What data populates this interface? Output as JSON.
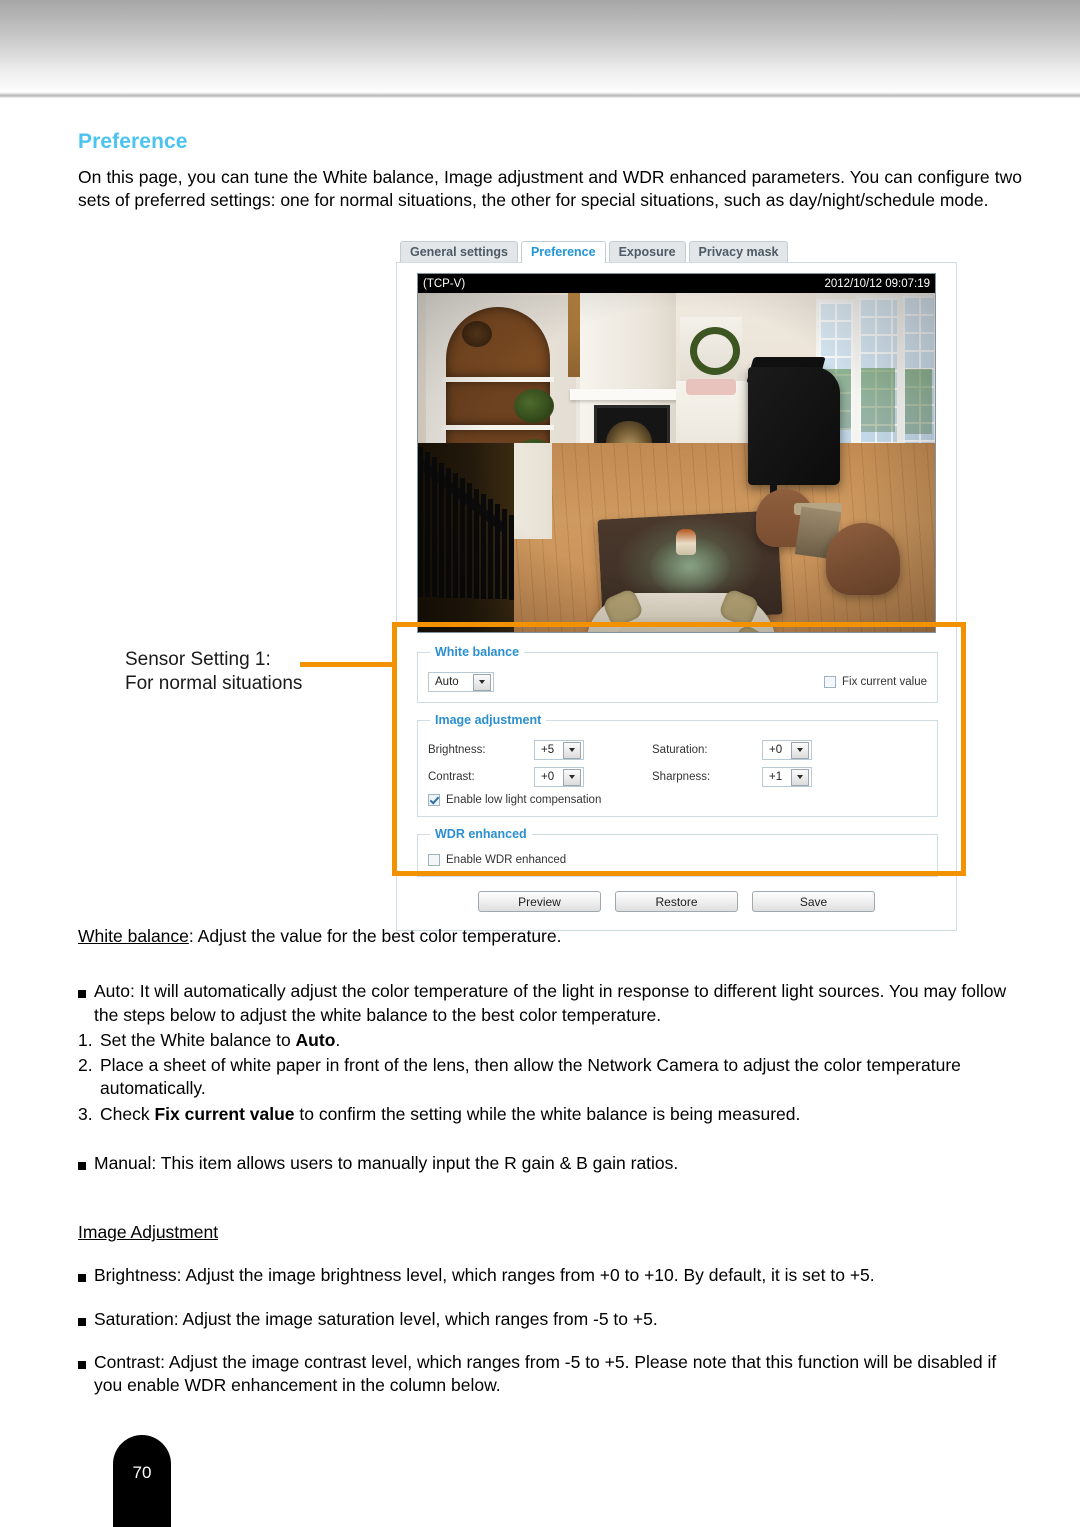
{
  "page": {
    "number": "70"
  },
  "section": {
    "title": "Preference",
    "intro": "On this page, you can tune the White balance, Image adjustment and WDR enhanced parameters. You can configure two sets of preferred settings: one for normal situations, the other for special situations, such as day/night/schedule mode."
  },
  "annotation": {
    "line1": "Sensor Setting 1:",
    "line2": "For normal situations",
    "accent_color": "#f39200"
  },
  "ui": {
    "tabs": [
      {
        "label": "General settings",
        "active": false
      },
      {
        "label": "Preference",
        "active": true
      },
      {
        "label": "Exposure",
        "active": false
      },
      {
        "label": "Privacy mask",
        "active": false
      }
    ],
    "video": {
      "osd_left": "(TCP-V)",
      "osd_right": "2012/10/12 09:07:19"
    },
    "white_balance": {
      "legend": "White balance",
      "mode_value": "Auto",
      "fix_current_value_label": "Fix current value",
      "fix_current_value_checked": false
    },
    "image_adjustment": {
      "legend": "Image adjustment",
      "brightness_label": "Brightness:",
      "brightness_value": "+5",
      "contrast_label": "Contrast:",
      "contrast_value": "+0",
      "saturation_label": "Saturation:",
      "saturation_value": "+0",
      "sharpness_label": "Sharpness:",
      "sharpness_value": "+1",
      "low_light_label": "Enable low light compensation",
      "low_light_checked": true
    },
    "wdr": {
      "legend": "WDR enhanced",
      "enable_label": "Enable WDR enhanced",
      "enable_checked": false
    },
    "buttons": {
      "preview": "Preview",
      "restore": "Restore",
      "save": "Save"
    }
  },
  "body": {
    "wb_lead": "White balance",
    "wb_rest": ": Adjust the value for the best color temperature.",
    "auto_bullet": "Auto: It will automatically adjust the color temperature of the light in response to different light sources. You may follow the steps below to adjust the white balance to the best color temperature.",
    "step1_num": "1.",
    "step1_a": "Set the White balance to ",
    "step1_b": "Auto",
    "step1_c": ".",
    "step2_num": "2.",
    "step2": "Place a sheet of white paper in front of the lens, then allow the Network Camera to adjust the color temperature automatically.",
    "step3_num": "3.",
    "step3_a": "Check ",
    "step3_b": "Fix current value",
    "step3_c": " to confirm the setting while the white balance is being measured.",
    "manual_bullet": "Manual: This item allows users to manually input the R gain & B gain ratios.",
    "image_adjustment_head": "Image Adjustment",
    "brightness_bullet": "Brightness: Adjust the image brightness level, which ranges from +0 to +10. By default, it is set to +5.",
    "saturation_bullet": "Saturation: Adjust the image saturation level, which ranges from -5 to +5.",
    "contrast_bullet": "Contrast: Adjust the image contrast level, which ranges from -5 to +5. Please note that this function will be disabled if you enable WDR enhancement in the column below."
  }
}
